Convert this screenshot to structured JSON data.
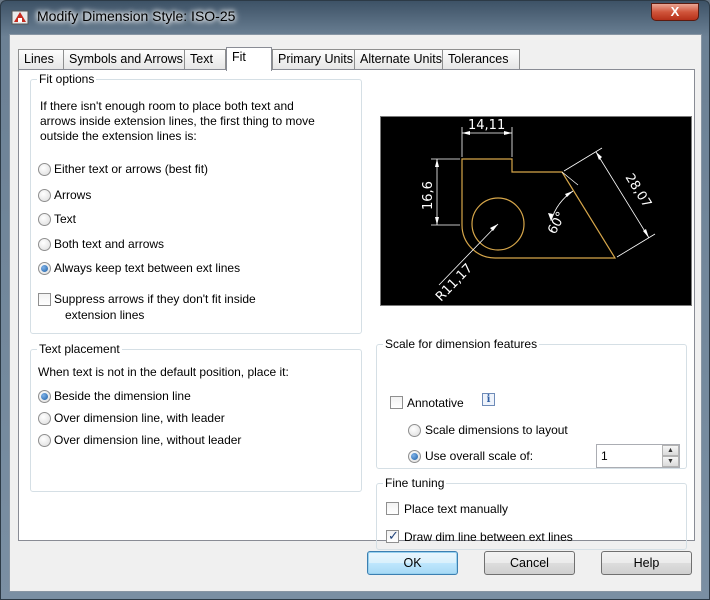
{
  "window": {
    "title": "Modify Dimension Style: ISO-25",
    "close_symbol": "X",
    "app_icon": "autocad-icon"
  },
  "tabs": [
    {
      "label": "Lines",
      "active": false
    },
    {
      "label": "Symbols and Arrows",
      "active": false
    },
    {
      "label": "Text",
      "active": false
    },
    {
      "label": "Fit",
      "active": true
    },
    {
      "label": "Primary Units",
      "active": false
    },
    {
      "label": "Alternate Units",
      "active": false
    },
    {
      "label": "Tolerances",
      "active": false
    }
  ],
  "fit_options": {
    "label": "Fit options",
    "description": "If there isn't enough room to place both text and arrows inside extension lines, the first thing to move outside the extension lines is:",
    "options": [
      {
        "label": "Either text or arrows (best fit)",
        "checked": false
      },
      {
        "label": "Arrows",
        "checked": false
      },
      {
        "label": "Text",
        "checked": false
      },
      {
        "label": "Both text and arrows",
        "checked": false
      },
      {
        "label": "Always keep text between ext lines",
        "checked": true
      }
    ],
    "suppress_label_line1": "Suppress arrows if they don't fit inside",
    "suppress_label_line2": "extension lines",
    "suppress_checked": false
  },
  "text_placement": {
    "label": "Text placement",
    "description": "When text is not in the default position, place it:",
    "options": [
      {
        "label": "Beside the dimension line",
        "checked": true
      },
      {
        "label": "Over dimension line, with leader",
        "checked": false
      },
      {
        "label": "Over dimension line, without leader",
        "checked": false
      }
    ]
  },
  "preview": {
    "dim_top": "14,11",
    "dim_left": "16,6",
    "dim_right": "28,07",
    "dim_angle": "60°",
    "dim_radius": "R11,17",
    "colors": {
      "background": "#000000",
      "geometry": "#d6a64a",
      "dimension": "#ffffff"
    }
  },
  "scale": {
    "label": "Scale for dimension features",
    "annotative_label": "Annotative",
    "annotative_checked": false,
    "info_icon": "info-icon",
    "info_glyph": "i",
    "layout_label": "Scale dimensions to layout",
    "layout_checked": false,
    "overall_label": "Use overall scale of:",
    "overall_checked": true,
    "overall_value": "1",
    "spin_up_glyph": "▲",
    "spin_down_glyph": "▼"
  },
  "fine_tuning": {
    "label": "Fine tuning",
    "place_manual_label": "Place text manually",
    "place_manual_checked": false,
    "draw_dim_label": "Draw dim line between ext lines",
    "draw_dim_checked": true,
    "check_glyph": "✓"
  },
  "buttons": {
    "ok": "OK",
    "cancel": "Cancel",
    "help": "Help"
  }
}
